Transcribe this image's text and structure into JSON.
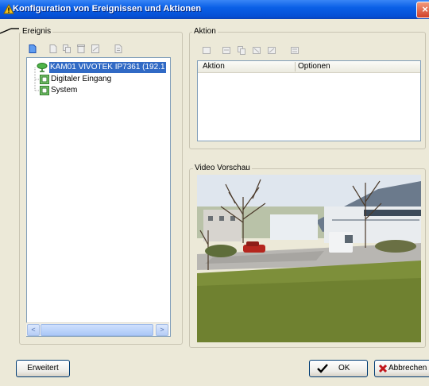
{
  "window": {
    "title": "Konfiguration von Ereignissen und Aktionen",
    "close_glyph": "×"
  },
  "ereignis": {
    "group_label": "Ereignis",
    "toolbar_icons": [
      "new-icon",
      "copy-icon",
      "paste-icon",
      "delete-icon",
      "edit-icon",
      "properties-icon"
    ],
    "tree": [
      {
        "label": "KAM01 VIVOTEK IP7361 (192.1",
        "icon": "camera-node-icon",
        "selected": true
      },
      {
        "label": "Digitaler Eingang",
        "icon": "input-node-icon",
        "selected": false
      },
      {
        "label": "System",
        "icon": "system-node-icon",
        "selected": false
      }
    ],
    "scroll_left_glyph": "<",
    "scroll_right_glyph": ">"
  },
  "aktion": {
    "group_label": "Aktion",
    "toolbar_icons": [
      "action-new-icon",
      "action-copy-icon",
      "action-paste-icon",
      "action-delete-icon",
      "action-edit-icon",
      "action-properties-icon"
    ],
    "columns": [
      "Aktion",
      "Optionen"
    ]
  },
  "video": {
    "group_label": "Video Vorschau"
  },
  "buttons": {
    "advanced": "Erweitert",
    "ok": "OK",
    "cancel": "Abbrechen"
  },
  "colors": {
    "title_bar": "#0a5fe6",
    "window_bg": "#ece9d8",
    "selection": "#316ac5"
  }
}
